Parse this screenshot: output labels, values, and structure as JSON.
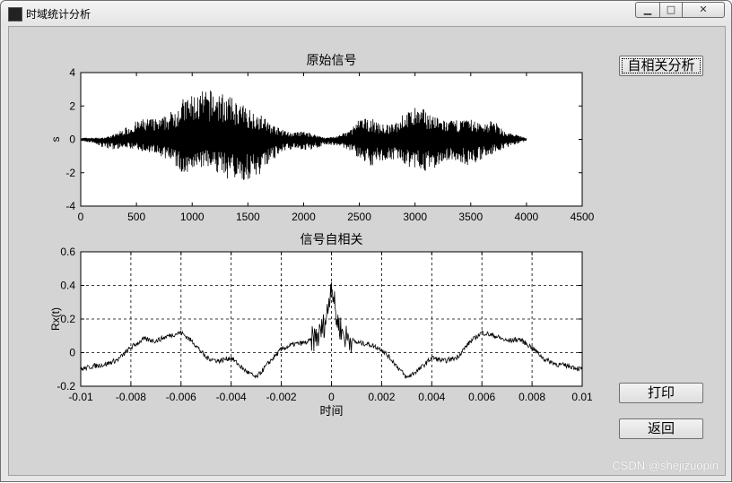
{
  "window": {
    "title": "时域统计分析"
  },
  "buttons": {
    "autocorr": "自相关分析",
    "print": "打印",
    "back": "返回"
  },
  "watermark": "CSDN @shejizuopin",
  "chart_data": [
    {
      "type": "line",
      "title": "原始信号",
      "xlabel": "",
      "ylabel": "s",
      "xlim": [
        0,
        4500
      ],
      "ylim": [
        -4,
        4
      ],
      "xticks": [
        "0",
        "500",
        "1000",
        "1500",
        "2000",
        "2500",
        "3000",
        "3500",
        "4000",
        "4500"
      ],
      "yticks": [
        "4",
        "2",
        "0",
        "-2",
        "-4"
      ],
      "grid": false,
      "envelope": {
        "x": [
          0,
          100,
          200,
          300,
          400,
          500,
          600,
          700,
          800,
          900,
          1000,
          1100,
          1200,
          1300,
          1400,
          1500,
          1600,
          1700,
          1800,
          1900,
          2000,
          2100,
          2200,
          2300,
          2400,
          2500,
          2600,
          2700,
          2800,
          2900,
          3000,
          3100,
          3200,
          3300,
          3400,
          3500,
          3600,
          3700,
          3800,
          3900,
          4000
        ],
        "upper": [
          0.1,
          0.1,
          0.1,
          0.3,
          0.7,
          1.1,
          1.3,
          1.2,
          1.6,
          2.4,
          2.7,
          2.9,
          3.0,
          2.7,
          2.3,
          1.9,
          1.6,
          1.0,
          0.6,
          0.4,
          0.5,
          0.3,
          0.1,
          0.2,
          0.5,
          1.2,
          1.3,
          0.9,
          0.9,
          1.6,
          1.9,
          1.8,
          1.3,
          1.1,
          1.2,
          1.2,
          1.0,
          1.2,
          0.5,
          0.3,
          0.1
        ],
        "lower": [
          -0.1,
          -0.2,
          -0.5,
          -0.6,
          -0.5,
          -0.6,
          -0.8,
          -1.0,
          -1.3,
          -2.1,
          -2.2,
          -1.7,
          -1.9,
          -2.3,
          -2.6,
          -2.5,
          -2.2,
          -1.5,
          -0.8,
          -0.6,
          -0.7,
          -0.6,
          -0.3,
          -0.4,
          -0.6,
          -1.2,
          -1.6,
          -1.3,
          -1.2,
          -1.6,
          -1.8,
          -1.9,
          -1.7,
          -1.3,
          -1.3,
          -1.7,
          -1.2,
          -0.9,
          -0.6,
          -0.3,
          -0.1
        ]
      }
    },
    {
      "type": "line",
      "title": "信号自相关",
      "xlabel": "时间",
      "ylabel": "Rx(t)",
      "xlim": [
        -0.01,
        0.01
      ],
      "ylim": [
        -0.2,
        0.6
      ],
      "xticks": [
        "-0.01",
        "-0.008",
        "-0.006",
        "-0.004",
        "-0.002",
        "0",
        "0.002",
        "0.004",
        "0.006",
        "0.008",
        "0.01"
      ],
      "yticks": [
        "0.6",
        "0.4",
        "0.2",
        "0",
        "-0.2"
      ],
      "grid": true,
      "x": [
        -0.01,
        -0.0095,
        -0.009,
        -0.0085,
        -0.008,
        -0.0075,
        -0.007,
        -0.0065,
        -0.006,
        -0.0055,
        -0.005,
        -0.0045,
        -0.004,
        -0.0035,
        -0.003,
        -0.0025,
        -0.002,
        -0.0015,
        -0.001,
        -0.0005,
        -0.0002,
        0,
        0.0002,
        0.0005,
        0.001,
        0.0015,
        0.002,
        0.0025,
        0.003,
        0.0035,
        0.004,
        0.0045,
        0.005,
        0.0055,
        0.006,
        0.0065,
        0.007,
        0.0075,
        0.008,
        0.0085,
        0.009,
        0.0095,
        0.01
      ],
      "y": [
        -0.1,
        -0.08,
        -0.07,
        -0.04,
        0.03,
        0.08,
        0.07,
        0.1,
        0.12,
        0.06,
        -0.03,
        -0.05,
        -0.03,
        -0.1,
        -0.15,
        -0.06,
        0.02,
        0.05,
        0.06,
        0.1,
        0.2,
        0.42,
        0.2,
        0.1,
        0.06,
        0.05,
        0.02,
        -0.06,
        -0.15,
        -0.1,
        -0.03,
        -0.05,
        -0.03,
        0.06,
        0.12,
        0.1,
        0.07,
        0.08,
        0.03,
        -0.04,
        -0.07,
        -0.08,
        -0.1
      ]
    }
  ]
}
